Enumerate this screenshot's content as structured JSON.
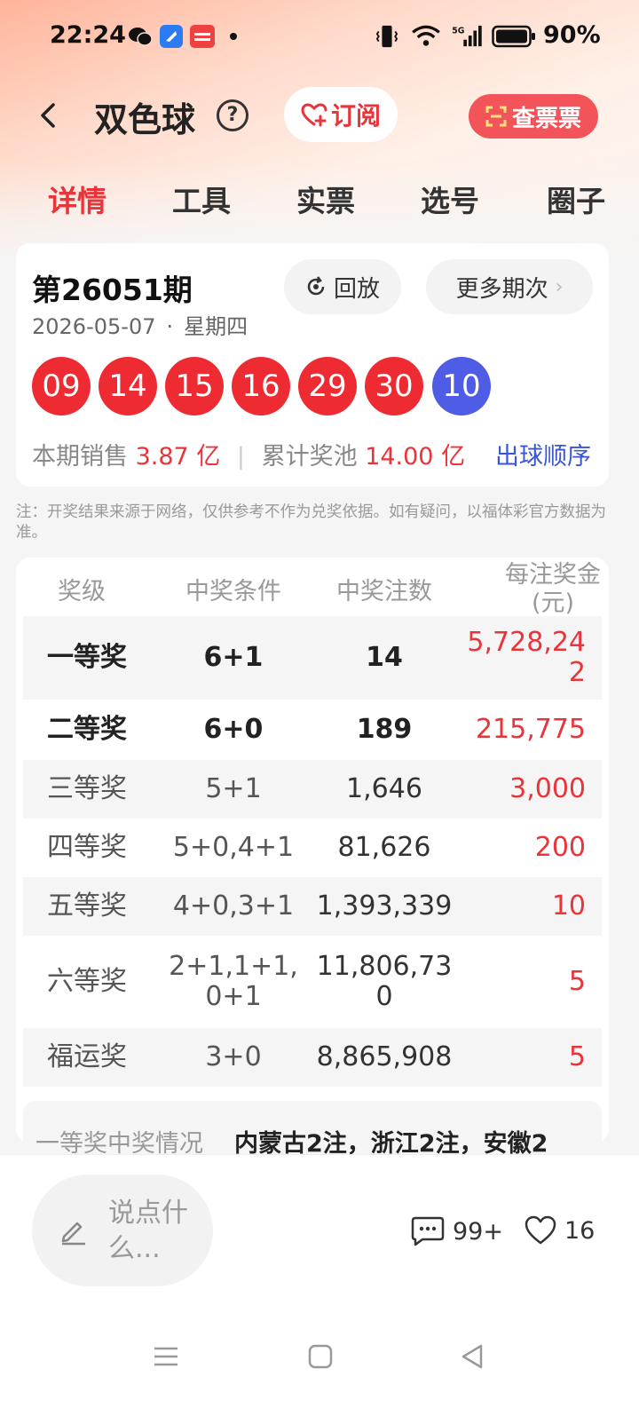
{
  "status": {
    "time": "22:24",
    "network": "5G",
    "battery": "90%"
  },
  "header": {
    "title": "双色球",
    "subscribe": "订阅",
    "check_ticket": "查票票"
  },
  "tabs": [
    "详情",
    "工具",
    "实票",
    "选号",
    "圈子"
  ],
  "draw": {
    "issue": "第26051期",
    "date": "2026-05-07",
    "weekday": "星期四",
    "replay": "回放",
    "more": "更多期次",
    "red_balls": [
      "09",
      "14",
      "15",
      "16",
      "29",
      "30"
    ],
    "blue_ball": "10",
    "sales_label": "本期销售",
    "sales_value": "3.87 亿",
    "pool_label": "累计奖池",
    "pool_value": "14.00 亿",
    "order_link": "出球顺序"
  },
  "note": "注：开奖结果来源于网络，仅供参考不作为兑奖依据。如有疑问，以福体彩官方数据为准。",
  "table": {
    "headers": [
      "奖级",
      "中奖条件",
      "中奖注数",
      "每注奖金(元)"
    ],
    "rows": [
      {
        "level": "一等奖",
        "cond": "6+1",
        "count": "14",
        "prize": "5,728,242"
      },
      {
        "level": "二等奖",
        "cond": "6+0",
        "count": "189",
        "prize": "215,775"
      },
      {
        "level": "三等奖",
        "cond": "5+1",
        "count": "1,646",
        "prize": "3,000"
      },
      {
        "level": "四等奖",
        "cond": "5+0,4+1",
        "count": "81,626",
        "prize": "200"
      },
      {
        "level": "五等奖",
        "cond": "4+0,3+1",
        "count": "1,393,339",
        "prize": "10"
      },
      {
        "level": "六等奖",
        "cond": "2+1,1+1,0+1",
        "count": "11,806,730",
        "prize": "5"
      },
      {
        "level": "福运奖",
        "cond": "3+0",
        "count": "8,865,908",
        "prize": "5"
      }
    ]
  },
  "first_prize": {
    "label": "一等奖中奖情况",
    "value": "内蒙古2注，浙江2注，安徽2"
  },
  "bottom": {
    "comment_placeholder": "说点什么...",
    "comments": "99+",
    "likes": "16"
  },
  "colors": {
    "accent_red": "#e8343a",
    "ball_red": "#ee2b32",
    "ball_blue": "#4e5ce6",
    "link_blue": "#3a56d4"
  }
}
